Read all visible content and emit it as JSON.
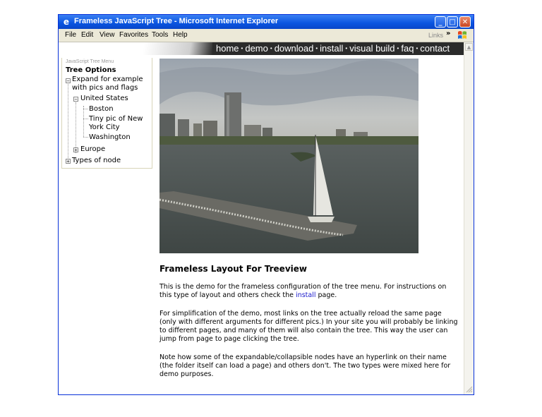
{
  "window": {
    "title": "Frameless JavaScript Tree - Microsoft Internet Explorer",
    "ie_icon": "ie-logo-icon",
    "controls": [
      "minimize",
      "maximize",
      "close"
    ]
  },
  "menubar": {
    "items": [
      "File",
      "Edit",
      "View",
      "Favorites",
      "Tools",
      "Help"
    ],
    "links_label": "Links",
    "chevron": "»"
  },
  "nav": {
    "links": [
      "home",
      "demo",
      "download",
      "install",
      "visual build",
      "faq",
      "contact"
    ],
    "separator": "•"
  },
  "tree": {
    "header": "JavaScript Tree Menu",
    "title": "Tree Options",
    "nodes": [
      {
        "label": "Expand for example with pics and flags",
        "state": "expanded"
      },
      {
        "label": "United States",
        "state": "expanded"
      },
      {
        "label": "Boston"
      },
      {
        "label": "Tiny pic of New York City"
      },
      {
        "label": "Washington"
      },
      {
        "label": "Europe",
        "state": "collapsed"
      },
      {
        "label": "Types of node",
        "state": "collapsed"
      }
    ]
  },
  "page": {
    "heading": "Frameless Layout For Treeview",
    "para1_before": "This is the demo for the frameless configuration of the tree menu. For instructions on this type of layout and others check the ",
    "para1_link": "install",
    "para1_after": " page.",
    "para2": "For simplification of the demo, most links on the tree actually reload the same page (only with different arguments for different pics.) In your site you will probably be linking to different pages, and many of them will also contain the tree. This way the user can jump from page to page clicking the tree.",
    "para3": "Note how some of the expandable/collapsible nodes have an hyperlink on their name (the folder itself can load a page) and others don't. The two types were mixed here for demo purposes."
  },
  "colors": {
    "titlebar": "#0a54e0",
    "nav_bg": "#2b2b2b",
    "link": "#1a1acc"
  }
}
